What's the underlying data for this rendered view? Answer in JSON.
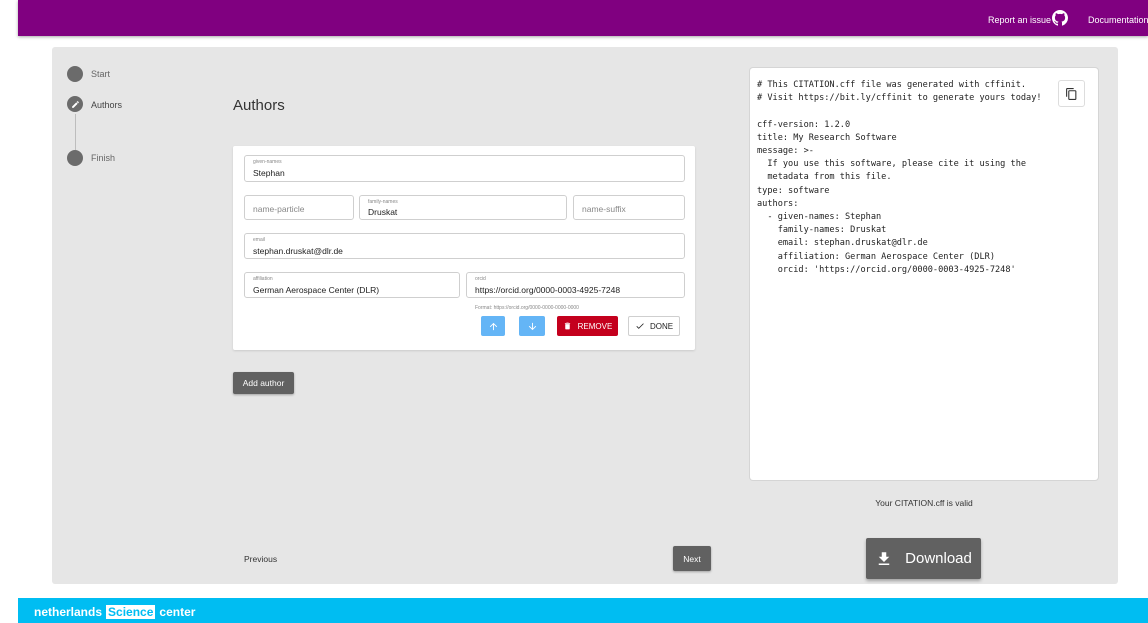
{
  "topbar": {
    "report_issue": "Report an issue",
    "documentation": "Documentation",
    "github_icon": "github-icon"
  },
  "stepper": [
    {
      "label": "Start",
      "icon": "circle-icon"
    },
    {
      "label": "Authors",
      "icon": "pencil-icon"
    },
    {
      "label": "Finish",
      "icon": "circle-icon"
    }
  ],
  "page_title": "Authors",
  "author": {
    "given_names": {
      "label": "given-names",
      "value": "Stephan"
    },
    "name_particle": {
      "placeholder": "name-particle"
    },
    "family_names": {
      "label": "family-names",
      "value": "Druskat"
    },
    "name_suffix": {
      "placeholder": "name-suffix"
    },
    "email": {
      "label": "email",
      "value": "stephan.druskat@dlr.de"
    },
    "affiliation": {
      "label": "affiliation",
      "value": "German Aerospace Center (DLR)"
    },
    "orcid": {
      "label": "orcid",
      "value": "https://orcid.org/0000-0003-4925-7248",
      "hint": "Format: https://orcid.org/0000-0000-0000-0000"
    },
    "remove_label": "REMOVE",
    "done_label": "DONE"
  },
  "add_author_label": "Add author",
  "cff_text": "# This CITATION.cff file was generated with cffinit.\n# Visit https://bit.ly/cffinit to generate yours today!\n\ncff-version: 1.2.0\ntitle: My Research Software\nmessage: >-\n  If you use this software, please cite it using the\n  metadata from this file.\ntype: software\nauthors:\n  - given-names: Stephan\n    family-names: Druskat\n    email: stephan.druskat@dlr.de\n    affiliation: German Aerospace Center (DLR)\n    orcid: 'https://orcid.org/0000-0003-4925-7248'",
  "valid_message": "Your CITATION.cff is valid",
  "nav": {
    "previous": "Previous",
    "next": "Next",
    "download": "Download"
  },
  "footer": {
    "logo_part1": "netherlands",
    "logo_part2": "Science",
    "logo_part3": "center"
  },
  "colors": {
    "topbar": "#800080",
    "footer": "#00bdf2",
    "remove": "#c4001d",
    "arrow_buttons": "#64b5f6"
  }
}
